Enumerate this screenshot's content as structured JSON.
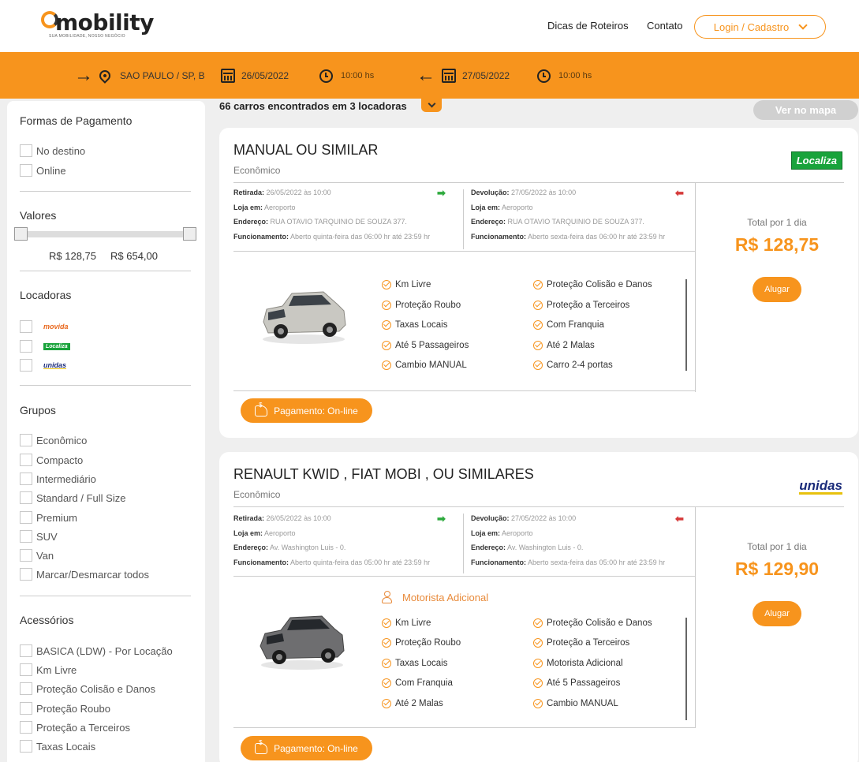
{
  "header": {
    "logo_word": "mobility",
    "logo_tagline": "SUA MOBILIDADE, NOSSO NEGÓCIO",
    "nav": [
      "Dicas de Roteiros",
      "Contato"
    ],
    "login_label": "Login / Cadastro"
  },
  "search": {
    "location": "SAO PAULO / SP, BRA",
    "pickup_date": "26/05/2022",
    "pickup_time": "10:00 hs",
    "return_date": "27/05/2022",
    "return_time": "10:00 hs"
  },
  "filters": {
    "payment_title": "Formas de Pagamento",
    "payment_options": [
      "No destino",
      "Online"
    ],
    "values_title": "Valores",
    "price_min": "R$ 128,75",
    "price_max": "R$ 654,00",
    "rentals_title": "Locadoras",
    "rental_companies": [
      "movida",
      "Localiza",
      "unidas"
    ],
    "groups_title": "Grupos",
    "groups": [
      "Econômico",
      "Compacto",
      "Intermediário",
      "Standard / Full Size",
      "Premium",
      "SUV",
      "Van",
      "Marcar/Desmarcar todos"
    ],
    "accessories_title": "Acessórios",
    "accessories": [
      "BASICA (LDW) - Por Locação",
      "Km Livre",
      "Proteção Colisão e Danos",
      "Proteção Roubo",
      "Proteção a Terceiros",
      "Taxas Locais"
    ]
  },
  "results": {
    "count_text": "66 carros encontrados em 3 locadoras",
    "map_button": "Ver no mapa"
  },
  "labels": {
    "pickup": "Retirada:",
    "return": "Devolução:",
    "store": "Loja em:",
    "address": "Endereço:",
    "hours": "Funcionamento:",
    "total": "Total por 1 dia",
    "rent": "Alugar",
    "payment": "Pagamento: On-line"
  },
  "cards": [
    {
      "title": "MANUAL OU SIMILAR",
      "category": "Econômico",
      "brand": "Localiza",
      "pickup_when": "26/05/2022 às 10:00",
      "pickup_store": "Aeroporto",
      "pickup_address": "RUA OTAVIO TARQUINIO DE SOUZA 377.",
      "pickup_hours": "Aberto quinta-feira das 06:00 hr até 23:59 hr",
      "return_when": "27/05/2022 às 10:00",
      "return_store": "Aeroporto",
      "return_address": "RUA OTAVIO TARQUINIO DE SOUZA 377.",
      "return_hours": "Aberto sexta-feira das 06:00 hr até 23:59 hr",
      "features_left": [
        "Km Livre",
        "Proteção Roubo",
        "Taxas Locais",
        "Até 5 Passageiros",
        "Cambio MANUAL"
      ],
      "features_right": [
        "Proteção Colisão e Danos",
        "Proteção a Terceiros",
        "Com Franquia",
        "Até 2 Malas",
        "Carro 2-4 portas"
      ],
      "price": "R$ 128,75",
      "car_color": "#c9c8c2"
    },
    {
      "title": "RENAULT KWID , FIAT MOBI , OU SIMILARES",
      "category": "Econômico",
      "brand": "unidas",
      "pickup_when": "26/05/2022 às 10:00",
      "pickup_store": "Aeroporto",
      "pickup_address": "Av. Washington Luis - 0.",
      "pickup_hours": "Aberto quinta-feira das 05:00 hr até 23:59 hr",
      "return_when": "27/05/2022 às 10:00",
      "return_store": "Aeroporto",
      "return_address": "Av. Washington Luis - 0.",
      "return_hours": "Aberto sexta-feira das 05:00 hr até 23:59 hr",
      "extra_driver": "Motorista Adicional",
      "features_left": [
        "Km Livre",
        "Proteção Roubo",
        "Taxas Locais",
        "Com Franquia",
        "Até 2 Malas"
      ],
      "features_right": [
        "Proteção Colisão e Danos",
        "Proteção a Terceiros",
        "Motorista Adicional",
        "Até 5 Passageiros",
        "Cambio MANUAL"
      ],
      "price": "R$ 129,90",
      "car_color": "#6e6e70"
    }
  ],
  "colors": {
    "accent": "#f7941d",
    "localiza_green": "#19a33b",
    "unidas_blue": "#1a2b7a"
  }
}
